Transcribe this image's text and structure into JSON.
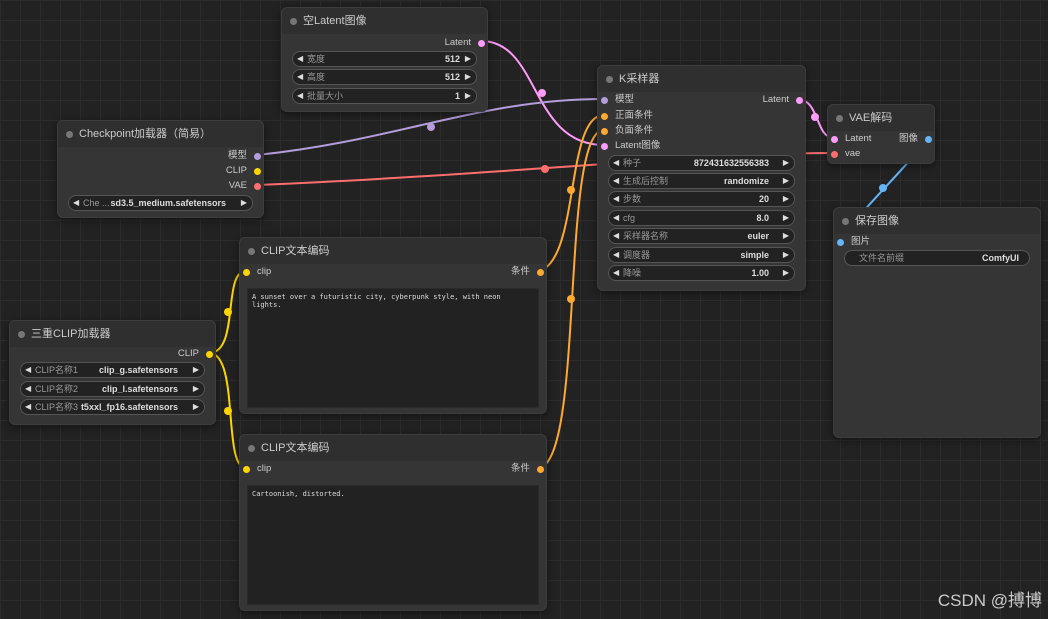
{
  "colors": {
    "latent": "#ff9cf9",
    "model": "#b39ddb",
    "clip": "#ffd500",
    "vae": "#ff6e6e",
    "conditioning": "#ffa931",
    "image": "#64b5f6"
  },
  "empty_latent": {
    "title": "空Latent图像",
    "out_latent": "Latent",
    "widgets": [
      {
        "label": "宽度",
        "value": "512"
      },
      {
        "label": "高度",
        "value": "512"
      },
      {
        "label": "批量大小",
        "value": "1"
      }
    ]
  },
  "checkpoint": {
    "title": "Checkpoint加载器（简易）",
    "out_model": "模型",
    "out_clip": "CLIP",
    "out_vae": "VAE",
    "ckpt_label": "Che ...",
    "ckpt_value": "sd3.5_medium.safetensors"
  },
  "ksampler": {
    "title": "K采样器",
    "in_model": "模型",
    "in_positive": "正面条件",
    "in_negative": "负面条件",
    "in_latent": "Latent图像",
    "out_latent": "Latent",
    "widgets": [
      {
        "label": "种子",
        "value": "872431632556383"
      },
      {
        "label": "生成后控制",
        "value": "randomize"
      },
      {
        "label": "步数",
        "value": "20"
      },
      {
        "label": "cfg",
        "value": "8.0"
      },
      {
        "label": "采样器名称",
        "value": "euler"
      },
      {
        "label": "调度器",
        "value": "simple"
      },
      {
        "label": "降噪",
        "value": "1.00"
      }
    ]
  },
  "vae_decode": {
    "title": "VAE解码",
    "in_latent": "Latent",
    "in_vae": "vae",
    "out_image": "图像"
  },
  "save_image": {
    "title": "保存图像",
    "in_images": "图片",
    "prefix_label": "文件名前缀",
    "prefix_value": "ComfyUI"
  },
  "clip_pos": {
    "title": "CLIP文本编码",
    "in_clip": "clip",
    "out_cond": "条件",
    "text": "A sunset over a futuristic city, cyberpunk style, with neon lights."
  },
  "clip_neg": {
    "title": "CLIP文本编码",
    "in_clip": "clip",
    "out_cond": "条件",
    "text": "Cartoonish, distorted."
  },
  "triple_clip": {
    "title": "三重CLIP加载器",
    "out_clip": "CLIP",
    "widgets": [
      {
        "label": "CLIP名称1",
        "value": "clip_g.safetensors"
      },
      {
        "label": "CLIP名称2",
        "value": "clip_l.safetensors"
      },
      {
        "label": "CLIP名称3",
        "value": "t5xxl_fp16.safetensors"
      }
    ]
  },
  "watermark": "CSDN @搏博"
}
